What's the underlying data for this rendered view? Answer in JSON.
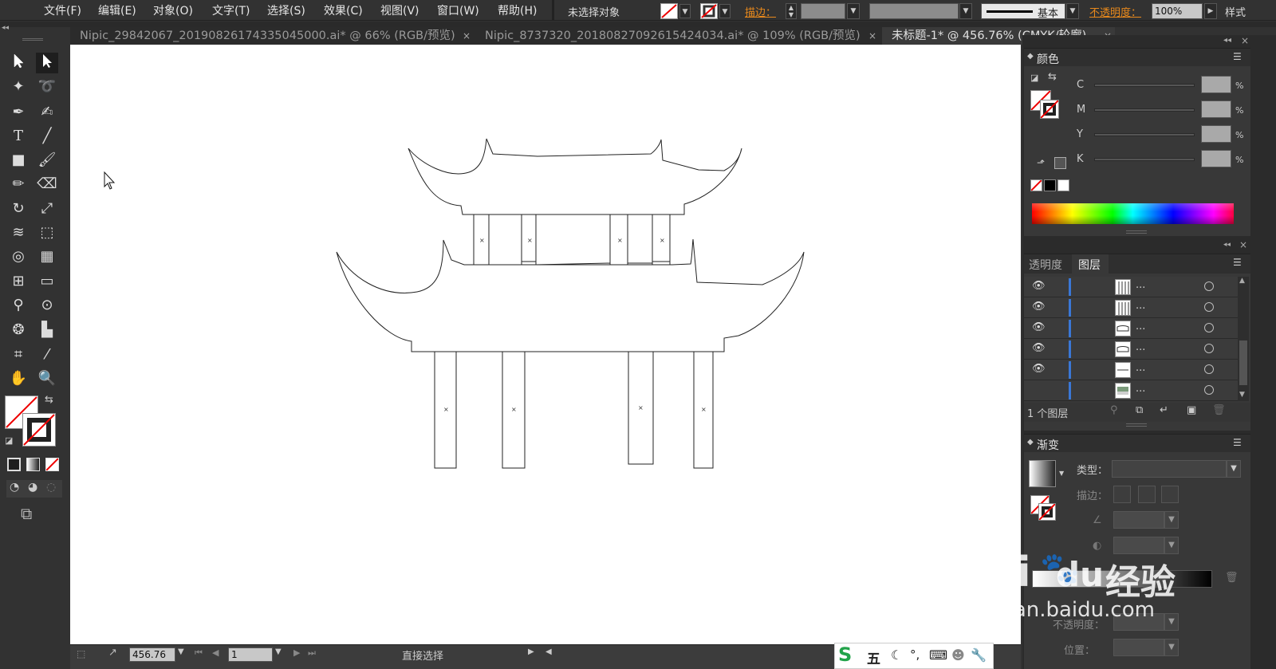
{
  "menubar": {
    "items": [
      "文件(F)",
      "编辑(E)",
      "对象(O)",
      "文字(T)",
      "选择(S)",
      "效果(C)",
      "视图(V)",
      "窗口(W)",
      "帮助(H)"
    ],
    "selection_status": "未选择对象",
    "stroke_label": "描边：",
    "stroke_style": "基本",
    "opacity_label": "不透明度：",
    "opacity_value": "100%",
    "style_label": "样式"
  },
  "tabs": [
    {
      "label": "Nipic_29842067_20190826174335045000.ai* @ 66% (RGB/预览)",
      "close": "×"
    },
    {
      "label": "Nipic_8737320_20180827092615424034.ai* @ 109% (RGB/预览)",
      "close": "×"
    },
    {
      "label": "未标题-1* @ 456.76% (CMYK/轮廓)",
      "close": "×"
    }
  ],
  "tools": {
    "icons": [
      "selection-icon",
      "direct-selection-icon",
      "magic-wand-icon",
      "lasso-icon",
      "pen-icon",
      "curvature-icon",
      "type-icon",
      "line-icon",
      "rectangle-icon",
      "paintbrush-icon",
      "pencil-icon",
      "eraser-icon",
      "rotate-icon",
      "scale-icon",
      "warp-icon",
      "free-transform-icon",
      "shape-builder-icon",
      "perspective-icon",
      "mesh-icon",
      "gradient-icon",
      "eyedropper-icon",
      "blend-icon",
      "symbol-sprayer-icon",
      "graph-icon",
      "artboard-icon",
      "slice-icon",
      "hand-icon",
      "zoom-icon"
    ]
  },
  "status": {
    "zoom": "456.76",
    "artboard": "1",
    "tool_name": "直接选择"
  },
  "color_panel": {
    "title": "颜色",
    "channels": [
      "C",
      "M",
      "Y",
      "K"
    ],
    "pct": "%"
  },
  "layers_panel": {
    "tab_transparency": "透明度",
    "tab_layers": "图层",
    "rows": [
      {
        "dots": "..."
      },
      {
        "dots": "..."
      },
      {
        "dots": "..."
      },
      {
        "dots": "..."
      },
      {
        "dots": "..."
      },
      {
        "dots": "..."
      }
    ],
    "count_label": "1 个图层"
  },
  "gradient_panel": {
    "title": "渐变",
    "type_label": "类型：",
    "stroke_label": "描边：",
    "opacity_label": "不透明度：",
    "position_label": "位置："
  },
  "ime_bar": {
    "mode": "五"
  },
  "watermark": {
    "brand": "Bai",
    "brand_suffix": "du",
    "product": "经验",
    "url": "jingyan.baidu.com"
  },
  "colors": {
    "accent": "#3a78d6",
    "warning_label": "#e8891c",
    "canvas": "#ffffff",
    "chrome": "#323232"
  }
}
